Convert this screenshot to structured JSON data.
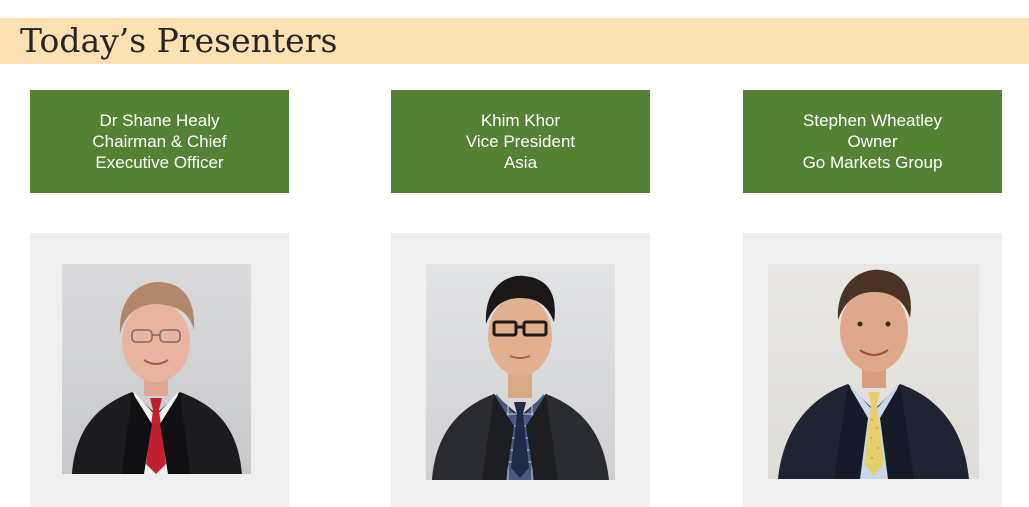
{
  "title": "Today’s Presenters",
  "presenters": [
    {
      "lines": [
        "Dr Shane Healy",
        "Chairman & Chief",
        "Executive Officer"
      ],
      "photo_icon": "person-photo-grey-haired-man-red-tie"
    },
    {
      "lines": [
        "Khim Khor",
        "Vice President",
        "Asia"
      ],
      "photo_icon": "person-photo-man-glasses-navy-tie"
    },
    {
      "lines": [
        "Stephen Wheatley",
        "Owner",
        "Go Markets Group"
      ],
      "photo_icon": "person-photo-man-yellow-tie"
    }
  ],
  "colors": {
    "title_band": "#fde1b3",
    "name_box": "#548235",
    "photo_frame": "#efefef"
  }
}
